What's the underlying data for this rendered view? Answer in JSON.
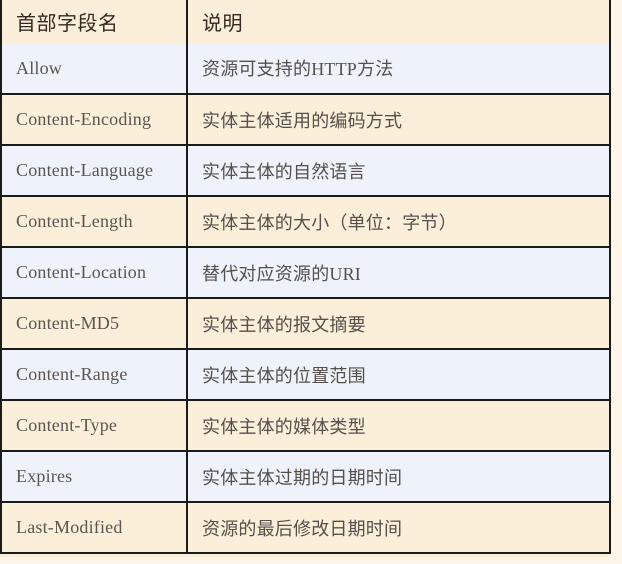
{
  "table": {
    "name": "entity-header-fields",
    "columns": [
      {
        "key": "field",
        "label": "首部字段名"
      },
      {
        "key": "description",
        "label": "说明"
      }
    ],
    "colors": {
      "header_background": "#FBEFD9",
      "row_background_odd": "#EDF2FB",
      "row_background_even": "#FBEFD9",
      "border": "#1a1a1a",
      "header_text": "#332b20",
      "body_text": "#55504b",
      "page_background": "#FDF6E8"
    },
    "rows": [
      {
        "field": "Allow",
        "description": "资源可支持的HTTP方法"
      },
      {
        "field": "Content-Encoding",
        "description": "实体主体适用的编码方式"
      },
      {
        "field": "Content-Language",
        "description": "实体主体的自然语言"
      },
      {
        "field": "Content-Length",
        "description": "实体主体的大小（单位：字节）"
      },
      {
        "field": "Content-Location",
        "description": "替代对应资源的URI"
      },
      {
        "field": "Content-MD5",
        "description": "实体主体的报文摘要"
      },
      {
        "field": "Content-Range",
        "description": "实体主体的位置范围"
      },
      {
        "field": "Content-Type",
        "description": "实体主体的媒体类型"
      },
      {
        "field": "Expires",
        "description": "实体主体过期的日期时间"
      },
      {
        "field": "Last-Modified",
        "description": "资源的最后修改日期时间"
      }
    ]
  }
}
